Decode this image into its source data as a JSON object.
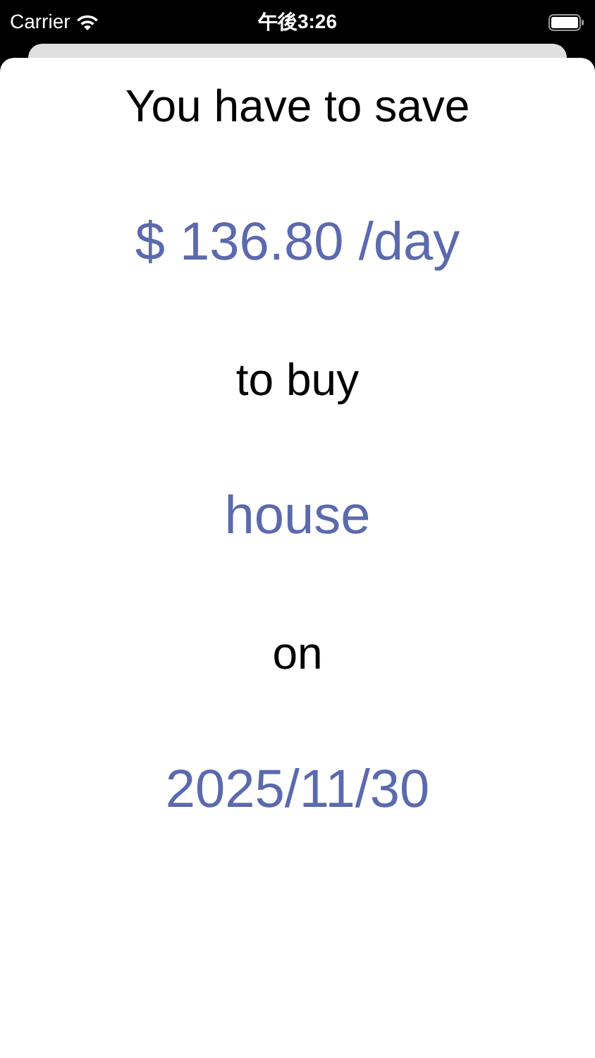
{
  "status_bar": {
    "carrier": "Carrier",
    "time": "午後3:26"
  },
  "lines": [
    {
      "kind": "plain",
      "text": "You have to save"
    },
    {
      "kind": "value",
      "text": "$ 136.80 /day"
    },
    {
      "kind": "plain",
      "text": "to buy"
    },
    {
      "kind": "value",
      "text": "house"
    },
    {
      "kind": "plain",
      "text": "on"
    },
    {
      "kind": "value",
      "text": "2025/11/30"
    }
  ]
}
